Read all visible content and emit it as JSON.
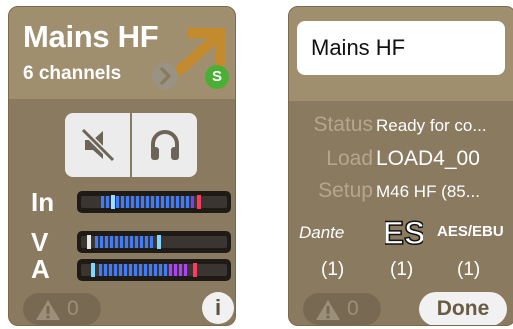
{
  "left_card": {
    "title": "Mains HF",
    "channels_label": "6 channels",
    "sync_badge": "S",
    "meters": {
      "in_label": "In",
      "v_label": "V",
      "a_label": "A"
    },
    "warnings_count": "0",
    "info_label": "i"
  },
  "right_card": {
    "name_value": "Mains HF",
    "status_key": "Status",
    "status_value": "Ready for co...",
    "load_key": "Load",
    "load_value": "LOAD4_00",
    "setup_key": "Setup",
    "setup_value": "M46 HF  (85...",
    "protocols": {
      "dante": "Dante",
      "es": "ES",
      "aes": "AES/EBU"
    },
    "counts": [
      "(1)",
      "(1)",
      "(1)"
    ],
    "warnings_count": "0",
    "done_label": "Done"
  },
  "colors": {
    "card_bg": "#8a7a5f",
    "card_top": "#a08f6e",
    "sync_green": "#4caf35",
    "meter_blue": "#3a7bff",
    "meter_peak": "#ff3a5a"
  },
  "icons": [
    "chevron-right-icon",
    "mute-speaker-icon",
    "headphones-icon",
    "warning-icon",
    "info-icon",
    "expand-arrow-icon"
  ]
}
